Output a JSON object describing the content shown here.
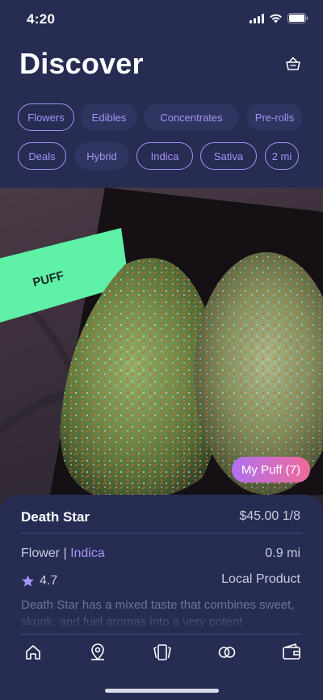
{
  "status_bar": {
    "time": "4:20"
  },
  "header": {
    "title": "Discover"
  },
  "filters": {
    "row1": [
      {
        "label": "Flowers",
        "selected": true
      },
      {
        "label": "Edibles",
        "selected": false
      },
      {
        "label": "Concentrates",
        "selected": false
      },
      {
        "label": "Pre-rolls",
        "selected": true
      }
    ],
    "row2": [
      {
        "label": "Deals",
        "selected": true
      },
      {
        "label": "Hybrid",
        "selected": false
      },
      {
        "label": "Indica",
        "selected": true
      },
      {
        "label": "Sativa",
        "selected": true
      },
      {
        "label": "2 mi",
        "selected": true
      }
    ]
  },
  "hero": {
    "banner_text": "PUFF",
    "my_puff_label": "My Puff (7)"
  },
  "product": {
    "name": "Death Star",
    "price": "$45.00 1/8",
    "category": "Flower | ",
    "strain": "Indica",
    "distance": "0.9 mi",
    "rating": "4.7",
    "origin": "Local Product",
    "description": "Death Star  has a mixed taste that combines sweet, skunk, and fuel aromas into a very potent"
  },
  "nav": {
    "items": [
      "home-icon",
      "map-pin-icon",
      "cards-icon",
      "circles-icon",
      "wallet-icon"
    ]
  },
  "colors": {
    "background": "#262c52",
    "accent": "#a592f5",
    "banner_green": "#5ef0a6",
    "pill_gradient_start": "#b070f0",
    "pill_gradient_end": "#f06a9a"
  }
}
